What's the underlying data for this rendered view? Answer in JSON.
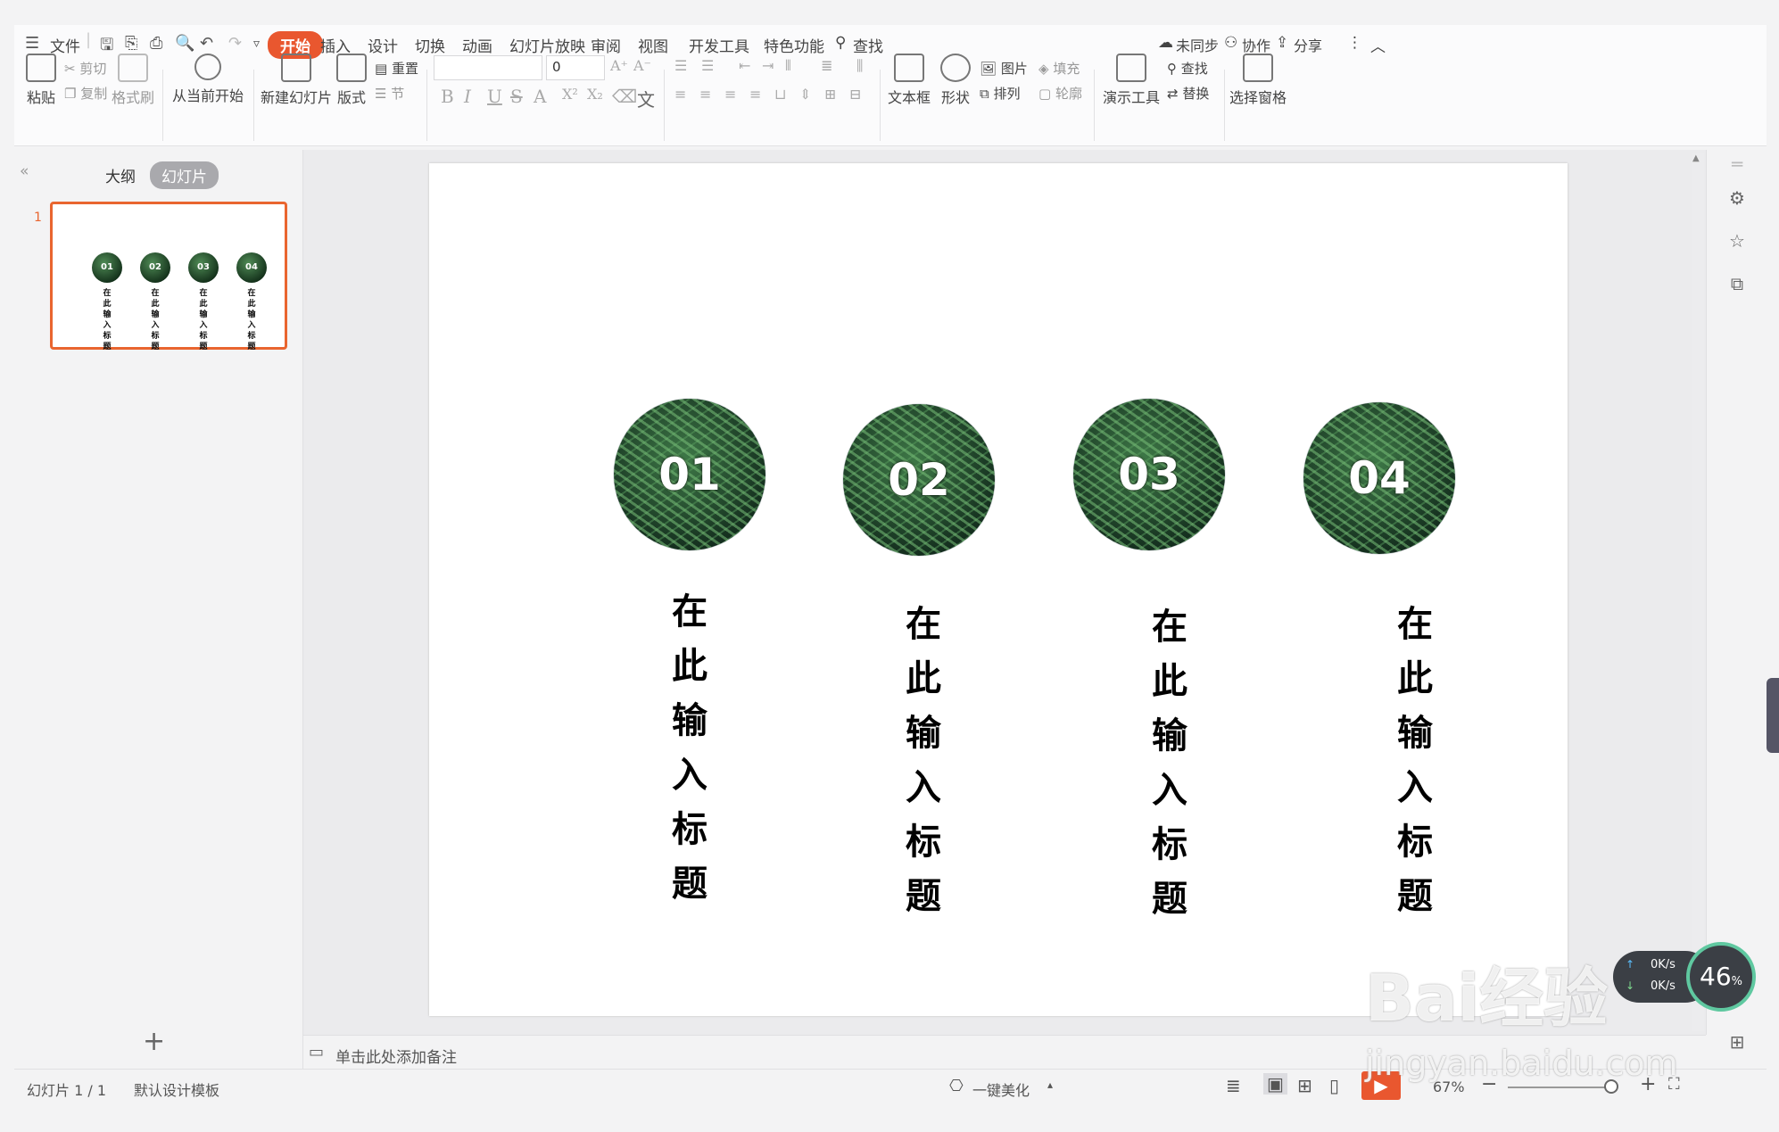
{
  "menu": {
    "file": "文件",
    "tabs": [
      "开始",
      "插入",
      "设计",
      "切换",
      "动画",
      "幻灯片放映",
      "审阅",
      "视图",
      "开发工具",
      "特色功能"
    ],
    "active_tab": "开始",
    "search": "查找",
    "sync": "未同步",
    "collab": "协作",
    "share": "分享"
  },
  "ribbon": {
    "paste": "粘贴",
    "cut": "剪切",
    "copy": "复制",
    "format_painter": "格式刷",
    "from_current": "从当前开始",
    "new_slide": "新建幻灯片",
    "layout": "版式",
    "reset": "重置",
    "section": "节",
    "font_size_value": "0",
    "textbox": "文本框",
    "shape": "形状",
    "picture": "图片",
    "fill": "填充",
    "arrange": "排列",
    "outline": "轮廓",
    "present_tools": "演示工具",
    "find": "查找",
    "replace": "替换",
    "select_pane": "选择窗格"
  },
  "left_panel": {
    "tab_outline": "大纲",
    "tab_slides": "幻灯片",
    "slide_number": "1",
    "add": "+"
  },
  "slide": {
    "items": [
      {
        "num": "01",
        "title": [
          "在",
          "此",
          "输",
          "入",
          "标",
          "题"
        ]
      },
      {
        "num": "02",
        "title": [
          "在",
          "此",
          "输",
          "入",
          "标",
          "题"
        ]
      },
      {
        "num": "03",
        "title": [
          "在",
          "此",
          "输",
          "入",
          "标",
          "题"
        ]
      },
      {
        "num": "04",
        "title": [
          "在",
          "此",
          "输",
          "入",
          "标",
          "题"
        ]
      }
    ]
  },
  "notes": {
    "placeholder": "单击此处添加备注"
  },
  "status": {
    "slide_counter": "幻灯片 1 / 1",
    "template": "默认设计模板",
    "beautify": "一键美化",
    "zoom": "67%"
  },
  "speed_widget": {
    "up": "0K/s",
    "down": "0K/s",
    "percent": "46",
    "percent_unit": "%"
  },
  "watermark": {
    "brand": "Bai经验",
    "url": "jingyan.baidu.com"
  },
  "colors": {
    "accent": "#e9572f",
    "thumb_border": "#e9652f",
    "circle_dark": "#10271a",
    "circle_light": "#3f7a48"
  }
}
